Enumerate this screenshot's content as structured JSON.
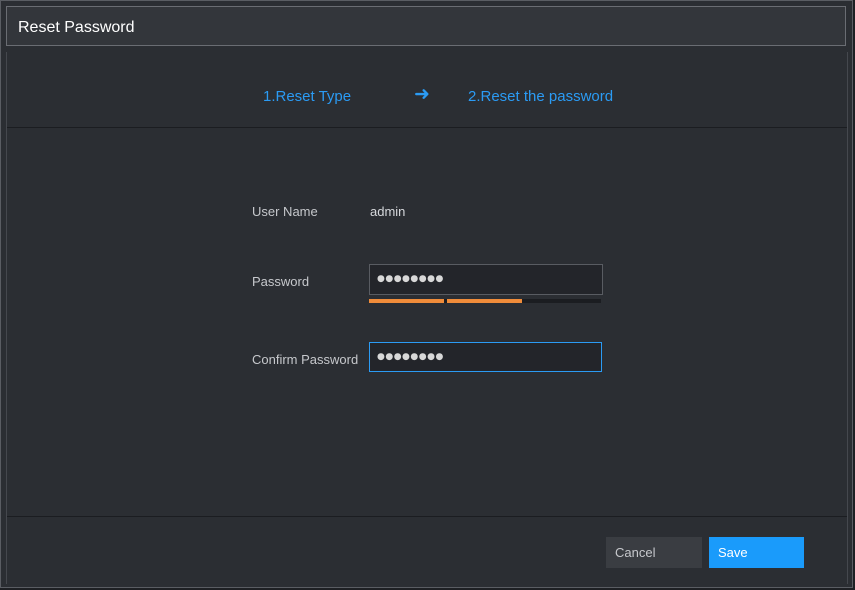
{
  "dialog": {
    "title": "Reset Password"
  },
  "steps": {
    "step1": "1.Reset Type",
    "arrow": "➜",
    "step2": "2.Reset the password"
  },
  "form": {
    "username_label": "User Name",
    "username_value": "admin",
    "password_label": "Password",
    "password_value": "●●●●●●●●",
    "confirm_label": "Confirm Password",
    "confirm_value": "●●●●●●●●",
    "strength_segments_filled": 2,
    "strength_segments_total": 3
  },
  "buttons": {
    "cancel": "Cancel",
    "save": "Save"
  },
  "colors": {
    "accent": "#2b9bf4",
    "save_button": "#1a9bfb",
    "strength_fill": "#f08c3a",
    "strength_empty": "#1b1d21"
  }
}
